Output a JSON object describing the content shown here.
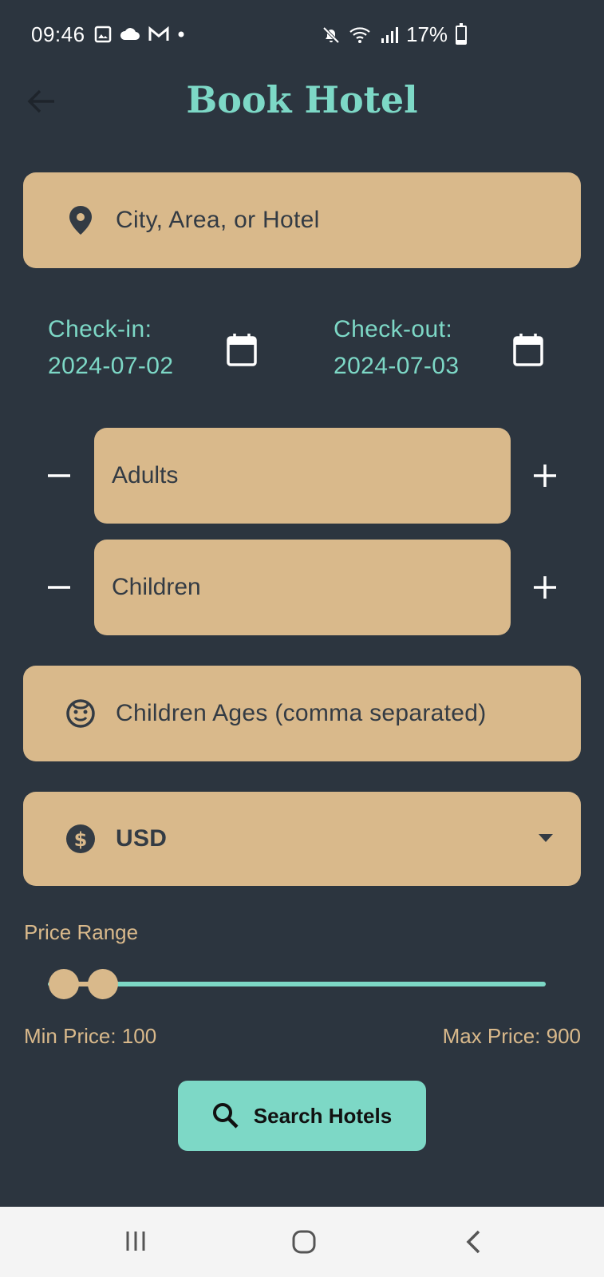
{
  "status_bar": {
    "time": "09:46",
    "battery": "17%",
    "icons": [
      "image-icon",
      "cloud-icon",
      "gmail-icon",
      "dot-icon",
      "mute-icon",
      "wifi-icon",
      "signal-icon",
      "battery-icon"
    ]
  },
  "header": {
    "title": "Book Hotel",
    "back_icon": "arrow-left-icon"
  },
  "location": {
    "placeholder": "City, Area, or Hotel",
    "icon": "location-pin-icon"
  },
  "dates": {
    "checkin_label": "Check-in:",
    "checkin_value": "2024-07-02",
    "checkout_label": "Check-out:",
    "checkout_value": "2024-07-03"
  },
  "guests": {
    "adults_label": "Adults",
    "children_label": "Children"
  },
  "children_ages": {
    "placeholder": "Children Ages (comma separated)",
    "icon": "child-face-icon"
  },
  "currency": {
    "selected": "USD",
    "icon": "dollar-circle-icon"
  },
  "price": {
    "section_label": "Price Range",
    "min_label": "Min Price: 100",
    "max_label": "Max Price: 900",
    "range_fraction": [
      0.0,
      0.08
    ]
  },
  "search_button": {
    "label": "Search Hotels",
    "icon": "search-icon"
  },
  "colors": {
    "background": "#2c353f",
    "accent": "#7dd8c6",
    "field": "#d9b98b"
  }
}
